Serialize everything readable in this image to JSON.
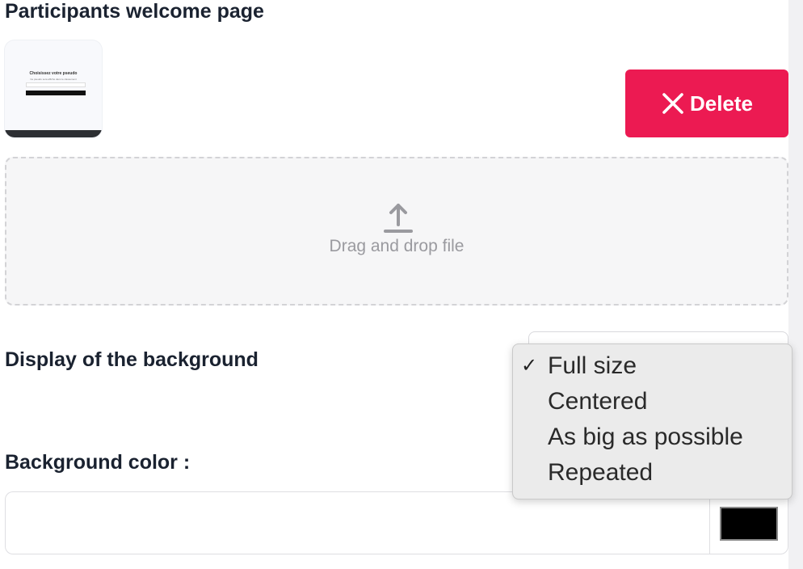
{
  "page": {
    "section_title": "Participants welcome page"
  },
  "thumbnail": {
    "title": "Choisissez votre pseudo",
    "subtitle": "Ce pseudo sera affiché dans le classement"
  },
  "actions": {
    "delete_label": "Delete",
    "delete_color": "#ec1a52"
  },
  "dropzone": {
    "label": "Drag and drop file",
    "icon": "upload-icon"
  },
  "background_display": {
    "label": "Display of the background",
    "selected": "Full size",
    "options": [
      "Full size",
      "Centered",
      "As big as possible",
      "Repeated"
    ]
  },
  "background_color": {
    "label": "Background color :",
    "value": "",
    "swatch_color": "#000000"
  }
}
